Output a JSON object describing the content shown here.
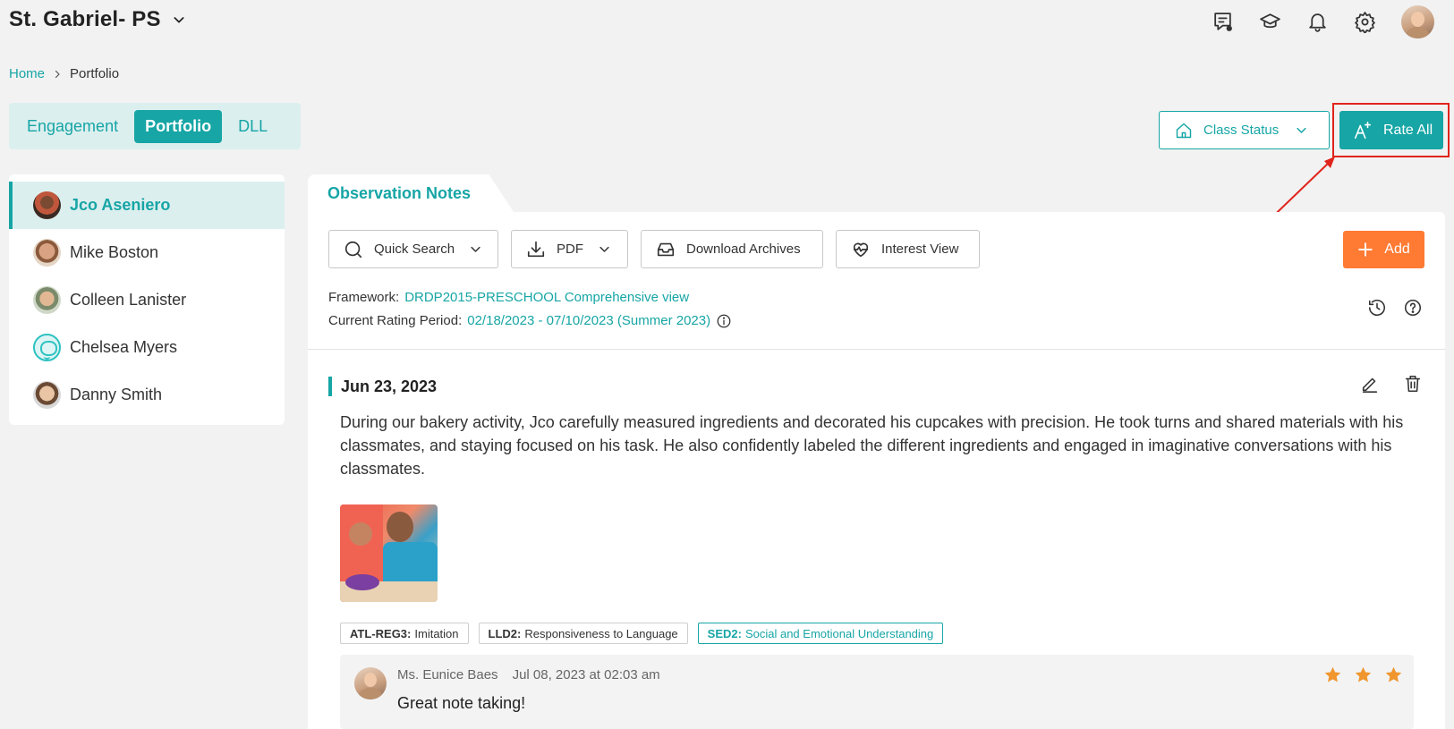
{
  "header": {
    "school_name": "St. Gabriel- PS",
    "icons": [
      "messages-icon",
      "graduation-cap-icon",
      "bell-icon",
      "gear-icon",
      "user-avatar"
    ]
  },
  "breadcrumb": {
    "home": "Home",
    "current": "Portfolio"
  },
  "tabs": [
    {
      "label": "Engagement",
      "active": false
    },
    {
      "label": "Portfolio",
      "active": true
    },
    {
      "label": "DLL",
      "active": false
    }
  ],
  "actions": {
    "class_status": "Class Status",
    "rate_all": "Rate All"
  },
  "students": [
    {
      "name": "Jco Aseniero",
      "active": true
    },
    {
      "name": "Mike Boston",
      "active": false
    },
    {
      "name": "Colleen Lanister",
      "active": false
    },
    {
      "name": "Chelsea Myers",
      "active": false
    },
    {
      "name": "Danny Smith",
      "active": false
    }
  ],
  "observation": {
    "tab_label": "Observation Notes",
    "toolbar": {
      "quick_search": "Quick Search",
      "pdf": "PDF",
      "download_archives": "Download Archives",
      "interest_view": "Interest View",
      "add": "Add"
    },
    "framework_label": "Framework:",
    "framework_value": "DRDP2015-PRESCHOOL Comprehensive view",
    "rating_period_label": "Current Rating Period:",
    "rating_period_value": "02/18/2023 - 07/10/2023 (Summer 2023)"
  },
  "note": {
    "date": "Jun 23, 2023",
    "text": "During our bakery activity, Jco carefully measured ingredients and decorated his cupcakes with precision. He took turns and shared materials with his classmates, and staying focused on his task. He also confidently labeled the different ingredients and engaged in imaginative conversations with his classmates.",
    "tags": [
      {
        "code": "ATL-REG3:",
        "label": "Imitation",
        "highlighted": false
      },
      {
        "code": "LLD2:",
        "label": "Responsiveness to Language",
        "highlighted": false
      },
      {
        "code": "SED2:",
        "label": "Social and Emotional Understanding",
        "highlighted": true
      }
    ],
    "comment": {
      "author": "Ms. Eunice Baes",
      "timestamp": "Jul 08, 2023 at 02:03 am",
      "text": "Great note taking!",
      "rating": 3
    }
  },
  "colors": {
    "accent": "#17a5a5",
    "add_button": "#ff7a33",
    "star": "#f0962e",
    "annotation": "#e0241b"
  }
}
